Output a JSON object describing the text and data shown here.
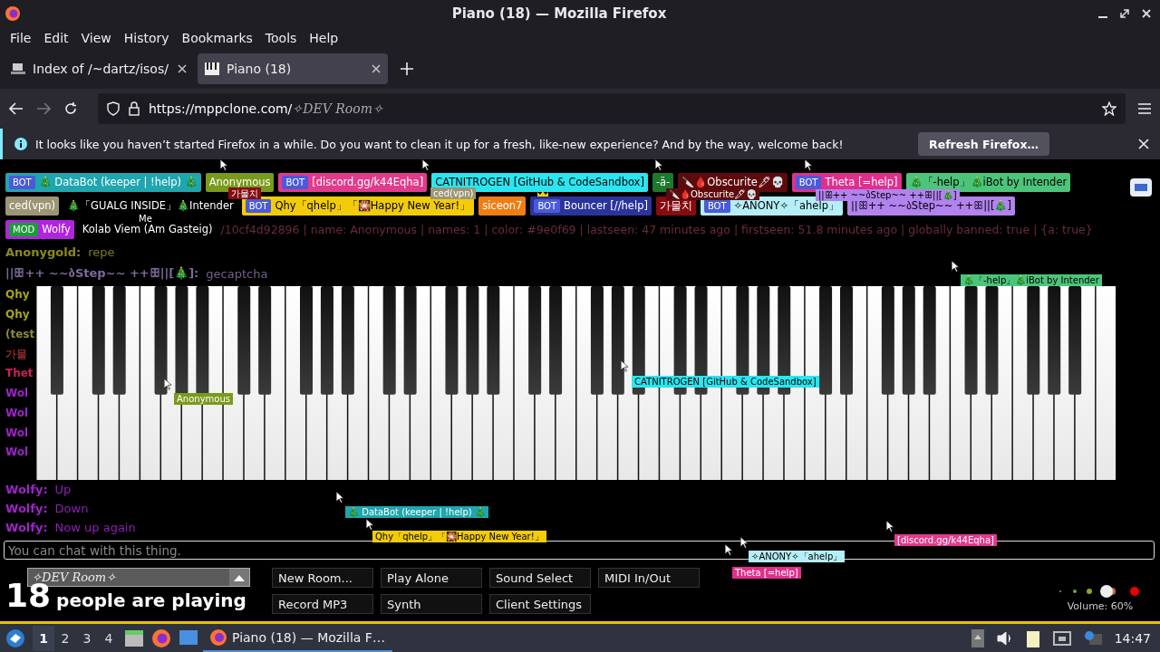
{
  "window": {
    "title": "Piano (18) — Mozilla Firefox"
  },
  "menu": [
    "File",
    "Edit",
    "View",
    "History",
    "Bookmarks",
    "Tools",
    "Help"
  ],
  "tabs": [
    {
      "label": "Index of /~dartz/isos/",
      "selected": false,
      "kind": "folder"
    },
    {
      "label": "Piano (18)",
      "selected": true,
      "kind": "piano"
    }
  ],
  "url": {
    "host": "https://mppclone.com/",
    "path": "✧DEV Room✧"
  },
  "notification": {
    "text": "It looks like you haven’t started Firefox in a while. Do you want to clean it up for a fresh, like-new experience? And by the way, welcome back!",
    "button": "Refresh Firefox…"
  },
  "users": [
    [
      {
        "name": "🎄 DataBot (keeper | !help) 🎄",
        "badge": "BOT",
        "color": "#1fa6ae"
      },
      {
        "name": "Anonymous",
        "color": "#7a9a1c"
      },
      {
        "name": "[discord.gg/k44Eqha]",
        "badge": "BOT",
        "color": "#e23a8c"
      },
      {
        "name": "CATNITROGEN [GitHub & CodeSandbox]",
        "color": "#2ae6f0"
      },
      {
        "name": "-ä-",
        "color": "#1c7a2c"
      },
      {
        "name": "🔪🩸Obscurite🖋💀",
        "color": "#5e0a0c"
      },
      {
        "name": "Theta [=help]",
        "badge": "BOT",
        "color": "#e0308c"
      },
      {
        "name": "🎄「-help」🎄iBot by Intender",
        "color": "#4cc47a"
      }
    ],
    [
      {
        "name": "ced(vpn)",
        "color": "#9c9676"
      },
      {
        "name": "🎄「GUALG INSIDE」🎄Intender"
      },
      {
        "name": "Qhy「qhelp」「🎇Happy New Year!」",
        "badge": "BOT",
        "color": "#f2cc08"
      },
      {
        "name": "siceon7",
        "color": "#f07e14"
      },
      {
        "name": "Bouncer [//help]",
        "badge": "BOT",
        "color": "#2b349c",
        "crown": true
      },
      {
        "name": "가물치",
        "color": "#860c10"
      },
      {
        "name": "✧ANONY✧「ahelp」",
        "badge": "BOT",
        "color": "#b4eef6"
      },
      {
        "name": "||ꕥ++ ~~ბStep~~ ++ꕥ||[🎄]",
        "color": "#b282ee"
      }
    ],
    [
      {
        "name": "Wolfy",
        "badge": "MOD",
        "color": "#b024e0"
      },
      {
        "name": "Kolab Viem (Am Gasteig)"
      }
    ]
  ],
  "info_line": "/10cf4d92896 | name: Anonymous | names: 1 | color: #9e0f69 | lastseen: 47 minutes ago | firstseen: 51.8 minutes ago | globally banned: true | {a: true}",
  "chat_top": [
    {
      "name": "Anonygold:",
      "message": "repe",
      "color": "#8a8a1a"
    },
    {
      "name": "||ꕥ++ ~~ბStep~~ ++ꕥ||[🎄]:",
      "message": "gecaptcha",
      "color": "#7e6a9a"
    }
  ],
  "chat_side": [
    {
      "name": "Qhy",
      "color": "#a8a41c"
    },
    {
      "name": "Qhy",
      "color": "#a8a41c"
    },
    {
      "name": "(test",
      "color": "#8a8a3a"
    },
    {
      "name": "가물",
      "color": "#8a2a2e"
    },
    {
      "name": "Thet",
      "color": "#c8205e"
    },
    {
      "name": "Wol",
      "color": "#9c24c8"
    },
    {
      "name": "Wol",
      "color": "#9c24c8"
    },
    {
      "name": "Wol",
      "color": "#9c24c8"
    },
    {
      "name": "Wol",
      "color": "#9c24c8"
    }
  ],
  "chat_bottom": [
    {
      "name": "Wolfy:",
      "message": "Up",
      "color": "#9c24c8"
    },
    {
      "name": "Wolfy:",
      "message": "Down",
      "color": "#9c24c8"
    },
    {
      "name": "Wolfy:",
      "message": "Now up again",
      "color": "#9c24c8"
    }
  ],
  "overlay_tags": [
    {
      "name": "가물치",
      "color": "#860c10"
    },
    {
      "name": "ced(vpn)",
      "color": "#9c9676"
    },
    {
      "name": "Me"
    },
    {
      "name": "🔪🩸Obscurite🖋💀",
      "color": "#5e0a0c"
    },
    {
      "name": "||ꕥ++ ~~ბStep~~ ++ꕥ||[🎄]",
      "color": "#b282ee"
    }
  ],
  "cursor_tags": [
    {
      "name": "Anonymous",
      "color": "#7a9a1c"
    },
    {
      "name": "CATNITROGEN [GitHub & CodeSandbox]",
      "color": "#2ae6f0"
    },
    {
      "name": "🎄「-help」🎄iBot by Intender",
      "color": "#4cc47a"
    },
    {
      "name": "🎄 DataBot (keeper | !help) 🎄",
      "color": "#1fa6ae"
    },
    {
      "name": "Qhy「qhelp」「🎇Happy New Year!」",
      "color": "#f2cc08"
    },
    {
      "name": "[discord.gg/k44Eqha]",
      "color": "#e23a8c"
    },
    {
      "name": "✧ANONY✧「ahelp」",
      "color": "#b4eef6"
    },
    {
      "name": "Theta [=help]",
      "color": "#e0308c"
    }
  ],
  "chat_input": {
    "placeholder": "You can chat with this thing."
  },
  "room": {
    "value": "✧DEV Room✧"
  },
  "player_count": "18",
  "player_label": "people are playing",
  "buttons": [
    "New Room...",
    "Play Alone",
    "Sound Select",
    "MIDI In/Out",
    "Record MP3",
    "Synth",
    "Client Settings"
  ],
  "volume": {
    "label": "Volume: 60%"
  },
  "taskbar": {
    "workspaces": [
      {
        "label": "1",
        "selected": true
      },
      {
        "label": "2",
        "selected": false
      },
      {
        "label": "3",
        "selected": false
      },
      {
        "label": "4",
        "selected": false
      }
    ],
    "task": "Piano (18) — Mozilla F…",
    "clock": "14:47"
  }
}
